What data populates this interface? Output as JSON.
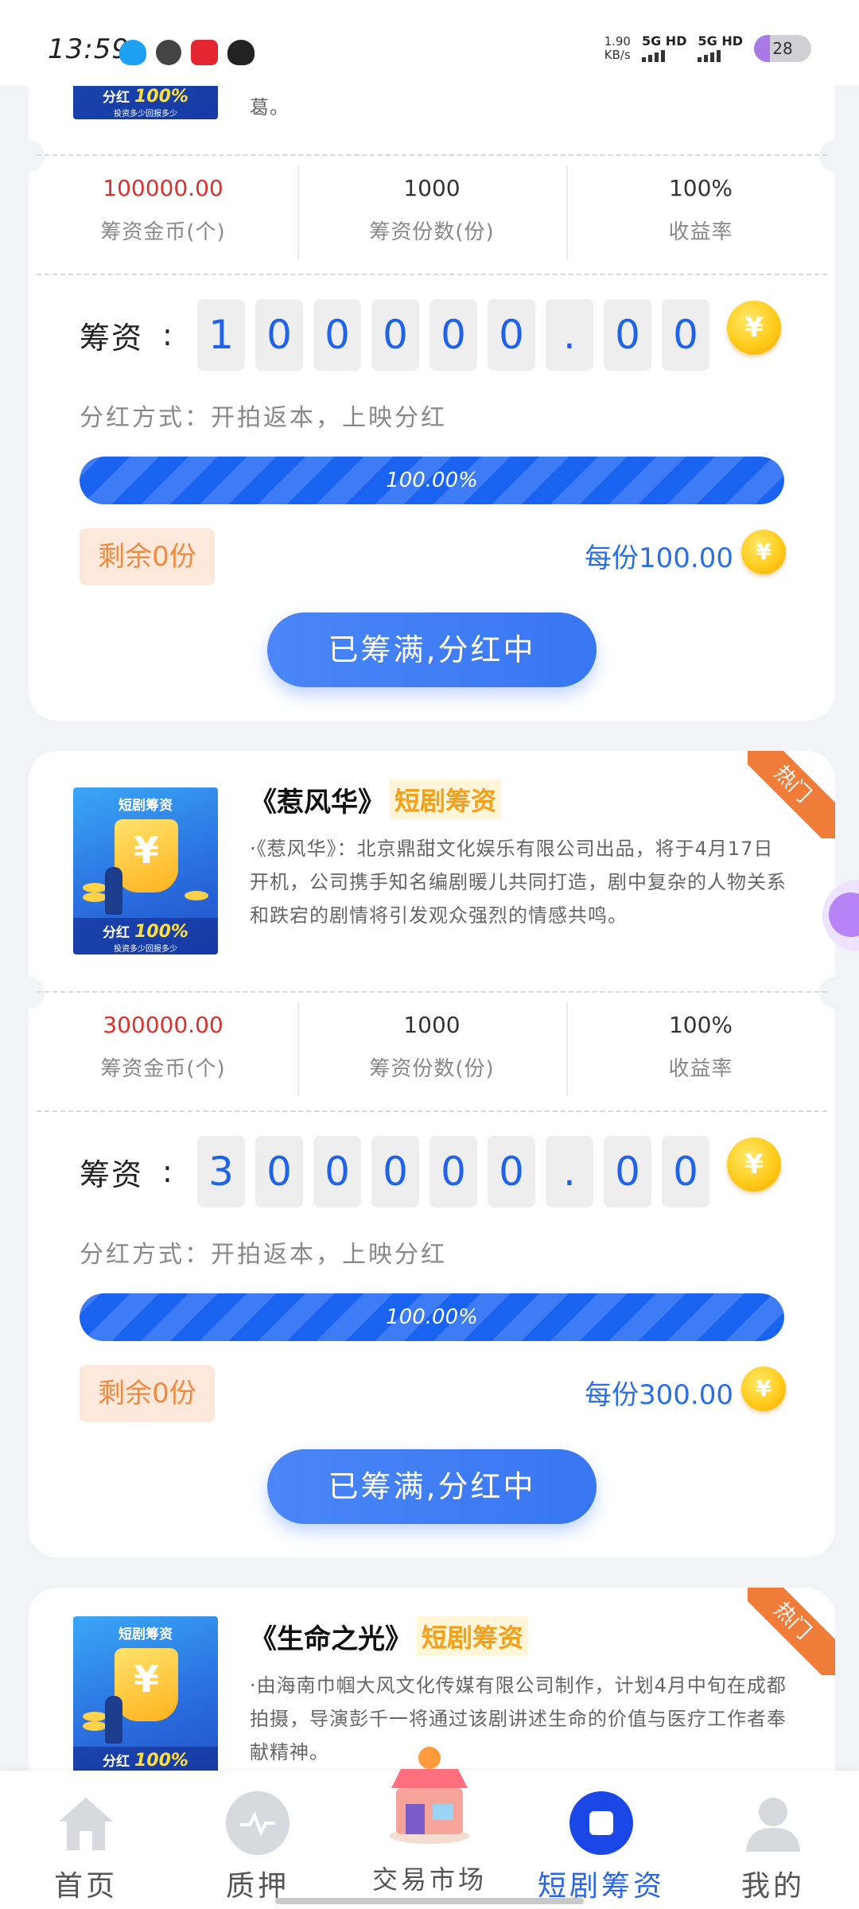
{
  "status_bar": {
    "time": "13:59",
    "net_speed_value": "1.90",
    "net_speed_unit": "KB/s",
    "signal1": "5G HD",
    "signal2": "5G HD",
    "battery": "28",
    "battery_level": 0.28
  },
  "card1": {
    "desc_tail": "葛。",
    "stats": [
      {
        "value": "100000.00",
        "label": "筹资金币(个)"
      },
      {
        "value": "1000",
        "label": "筹资份数(份)"
      },
      {
        "value": "100%",
        "label": "收益率"
      }
    ],
    "fund_label": "筹资",
    "fund_colon": ":",
    "digits": [
      "1",
      "0",
      "0",
      "0",
      "0",
      "0",
      ".",
      "0",
      "0"
    ],
    "method": "分红方式：开拍返本，上映分红",
    "progress_text": "100.00%",
    "progress_value": 1.0,
    "remaining": "剩余0份",
    "per_share": "每份100.00",
    "button": "已筹满,分红中"
  },
  "card2": {
    "hot": "热门",
    "title": "《惹风华》",
    "tag": "短剧筹资",
    "desc": "·《惹风华》：北京鼎甜文化娱乐有限公司出品，将于4月17日开机，公司携手知名编剧暖儿共同打造，剧中复杂的人物关系和跌宕的剧情将引发观众强烈的情感共鸣。",
    "stats": [
      {
        "value": "300000.00",
        "label": "筹资金币(个)"
      },
      {
        "value": "1000",
        "label": "筹资份数(份)"
      },
      {
        "value": "100%",
        "label": "收益率"
      }
    ],
    "fund_label": "筹资",
    "fund_colon": ":",
    "digits": [
      "3",
      "0",
      "0",
      "0",
      "0",
      "0",
      ".",
      "0",
      "0"
    ],
    "method": "分红方式：开拍返本，上映分红",
    "progress_text": "100.00%",
    "progress_value": 1.0,
    "remaining": "剩余0份",
    "per_share": "每份300.00",
    "button": "已筹满,分红中"
  },
  "card3": {
    "hot": "热门",
    "title": "《生命之光》",
    "tag": "短剧筹资",
    "desc": "·由海南巾帼大风文化传媒有限公司制作，计划4月中旬在成都拍摄，导演彭千一将通过该剧讲述生命的价值与医疗工作者奉献精神。"
  },
  "thumbnail": {
    "title": "短剧筹资",
    "symbol": "¥",
    "bottom_prefix": "分红",
    "bottom_percent": "100%",
    "bottom_sub": "投资多少回报多少"
  },
  "coin_symbol": "¥",
  "nav": [
    {
      "label": "首页",
      "icon": "home-icon"
    },
    {
      "label": "质押",
      "icon": "pulse-icon"
    },
    {
      "label": "交易市场",
      "icon": "market-icon"
    },
    {
      "label": "短剧筹资",
      "icon": "funding-icon"
    },
    {
      "label": "我的",
      "icon": "user-icon"
    }
  ],
  "colors": {
    "accent": "#2a64e8",
    "red_value": "#d9322e",
    "orange": "#f08a40",
    "tag": "#f4a01a"
  }
}
